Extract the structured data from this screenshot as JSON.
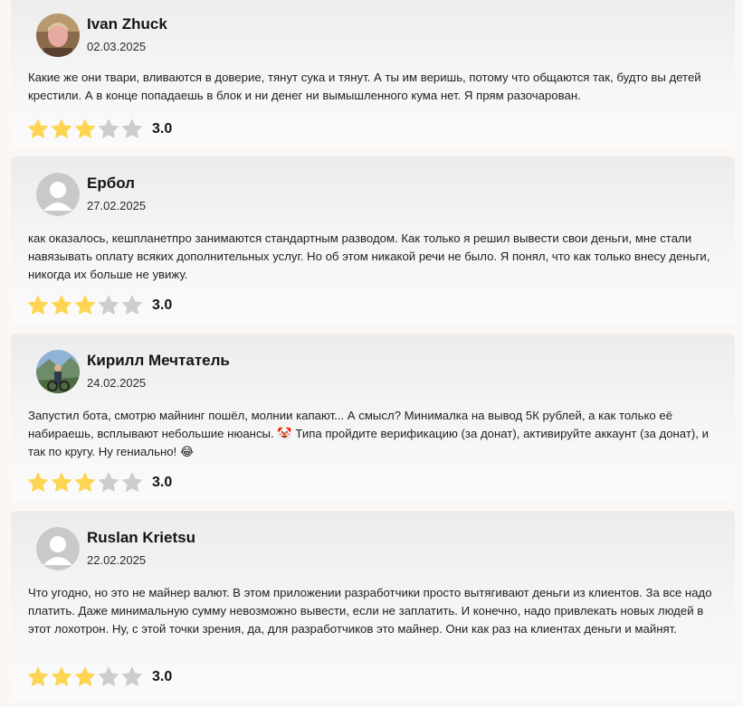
{
  "colors": {
    "star_filled": "#fdd553",
    "star_empty": "#cdcdcd",
    "card_bg": "#f2f2f2"
  },
  "reviews": [
    {
      "author": "Ivan Zhuck",
      "date": "02.03.2025",
      "avatar": "photo",
      "text": "Какие же они твари, вливаются в доверие, тянут сука и тянут. А ты им веришь, потому что общаются так, будто вы детей крестили. А в конце попадаешь в блок и ни денег ни вымышленного кума нет. Я прям разочарован.",
      "stars": 3,
      "score": "3.0"
    },
    {
      "author": "Ербол",
      "date": "27.02.2025",
      "avatar": "placeholder",
      "text": "как оказалось, кешпланетпро занимаются стандартным разводом. Как только я решил вывести свои деньги, мне стали навязывать оплату всяких дополнительных услуг. Но об этом никакой речи не было. Я понял, что как только внесу деньги, никогда их больше не увижу.",
      "stars": 3,
      "score": "3.0"
    },
    {
      "author": "Кирилл Мечтатель",
      "date": "24.02.2025",
      "avatar": "photo",
      "text": "Запустил бота, смотрю майнинг пошёл, молнии капают... А смысл? Минималка на вывод 5К рублей, а как только её набираешь, всплывают небольшие нюансы. 🤡 Типа пройдите верификацию (за донат), активируйте аккаунт (за донат), и так по кругу. Ну гениально! 😂",
      "stars": 3,
      "score": "3.0"
    },
    {
      "author": "Ruslan Krietsu",
      "date": "22.02.2025",
      "avatar": "placeholder",
      "text": "Что угодно, но это не майнер валют. В этом приложении разработчики просто вытягивают деньги из клиентов. За все надо платить. Даже минимальную сумму невозможно вывести, если не заплатить. И конечно, надо привлекать новых людей в этот лохотрон. Ну, с этой точки зрения, да, для разработчиков это майнер. Они как раз на клиентах деньги и майнят.",
      "stars": 3,
      "score": "3.0"
    }
  ]
}
